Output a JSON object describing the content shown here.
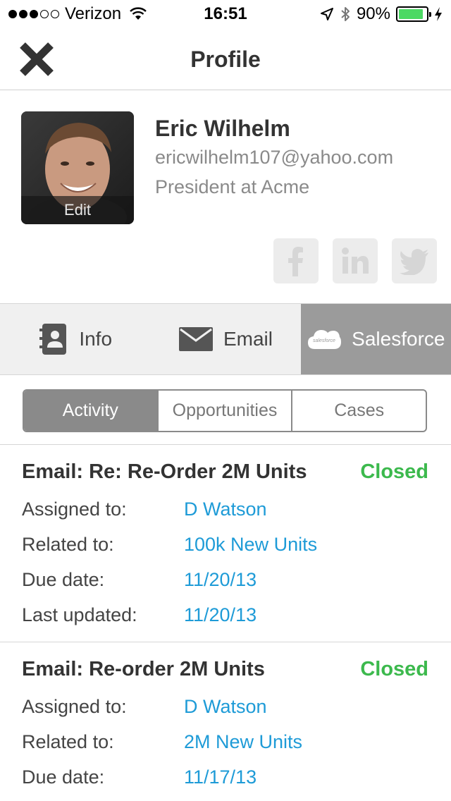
{
  "status_bar": {
    "carrier": "Verizon",
    "time": "16:51",
    "battery": "90%",
    "battery_level": 0.9,
    "icons": [
      "signal-dots-icon",
      "wifi-icon",
      "location-arrow-icon",
      "bluetooth-icon",
      "battery-icon",
      "charging-bolt-icon"
    ]
  },
  "nav": {
    "title": "Profile",
    "close_icon": "close-icon"
  },
  "profile": {
    "name": "Eric Wilhelm",
    "email": "ericwilhelm107@yahoo.com",
    "role": "President at Acme",
    "edit_label": "Edit",
    "social": [
      "facebook-icon",
      "linkedin-icon",
      "twitter-icon"
    ]
  },
  "tabs": [
    {
      "label": "Info",
      "icon": "contact-card-icon",
      "active": false
    },
    {
      "label": "Email",
      "icon": "envelope-icon",
      "active": false
    },
    {
      "label": "Salesforce",
      "icon": "salesforce-cloud-icon",
      "active": true
    }
  ],
  "salesforce_logo_text": "salesforce",
  "segments": [
    {
      "label": "Activity",
      "active": true
    },
    {
      "label": "Opportunities",
      "active": false
    },
    {
      "label": "Cases",
      "active": false
    }
  ],
  "activities": [
    {
      "title": "Email: Re: Re-Order 2M Units",
      "status": "Closed",
      "rows": [
        {
          "label": "Assigned to:",
          "value": "D Watson"
        },
        {
          "label": "Related to:",
          "value": "100k New Units"
        },
        {
          "label": "Due date:",
          "value": "11/20/13"
        },
        {
          "label": "Last updated:",
          "value": "11/20/13"
        }
      ]
    },
    {
      "title": "Email: Re-order 2M Units",
      "status": "Closed",
      "rows": [
        {
          "label": "Assigned to:",
          "value": "D Watson"
        },
        {
          "label": "Related to:",
          "value": "2M New Units"
        },
        {
          "label": "Due date:",
          "value": "11/17/13"
        }
      ]
    }
  ],
  "colors": {
    "status_closed": "#3cb94d",
    "link_blue": "#1e9bd7",
    "active_tab": "#9b9b9b",
    "battery_green": "#4cd964"
  }
}
